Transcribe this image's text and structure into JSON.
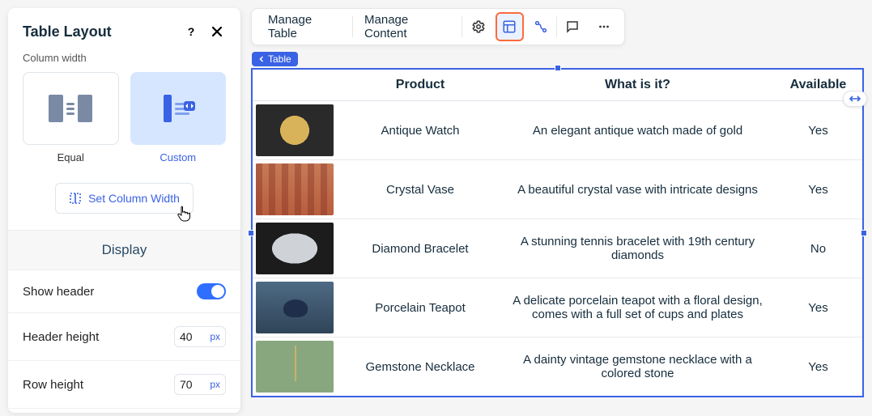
{
  "sidebar": {
    "title": "Table Layout",
    "column_width_label": "Column width",
    "equal_label": "Equal",
    "custom_label": "Custom",
    "set_column_width": "Set Column Width",
    "display_heading": "Display",
    "show_header_label": "Show header",
    "header_height_label": "Header height",
    "header_height_value": "40",
    "row_height_label": "Row height",
    "row_height_value": "70",
    "unit": "px"
  },
  "toolbar": {
    "manage_table": "Manage Table",
    "manage_content": "Manage Content"
  },
  "breadcrumb": {
    "label": "Table"
  },
  "table": {
    "headers": {
      "product": "Product",
      "desc": "What is it?",
      "available": "Available"
    },
    "rows": [
      {
        "product": "Antique Watch",
        "desc": "An elegant antique watch made of gold",
        "available": "Yes",
        "thumb": "watch"
      },
      {
        "product": "Crystal Vase",
        "desc": "A beautiful crystal vase with intricate designs",
        "available": "Yes",
        "thumb": "vase"
      },
      {
        "product": "Diamond Bracelet",
        "desc": "A stunning tennis bracelet with 19th century diamonds",
        "available": "No",
        "thumb": "bracelet"
      },
      {
        "product": "Porcelain Teapot",
        "desc": "A delicate porcelain teapot with a floral design, comes with a full set of cups and plates",
        "available": "Yes",
        "thumb": "teapot"
      },
      {
        "product": "Gemstone Necklace",
        "desc": "A dainty vintage gemstone necklace with a colored stone",
        "available": "Yes",
        "thumb": "necklace"
      }
    ]
  }
}
